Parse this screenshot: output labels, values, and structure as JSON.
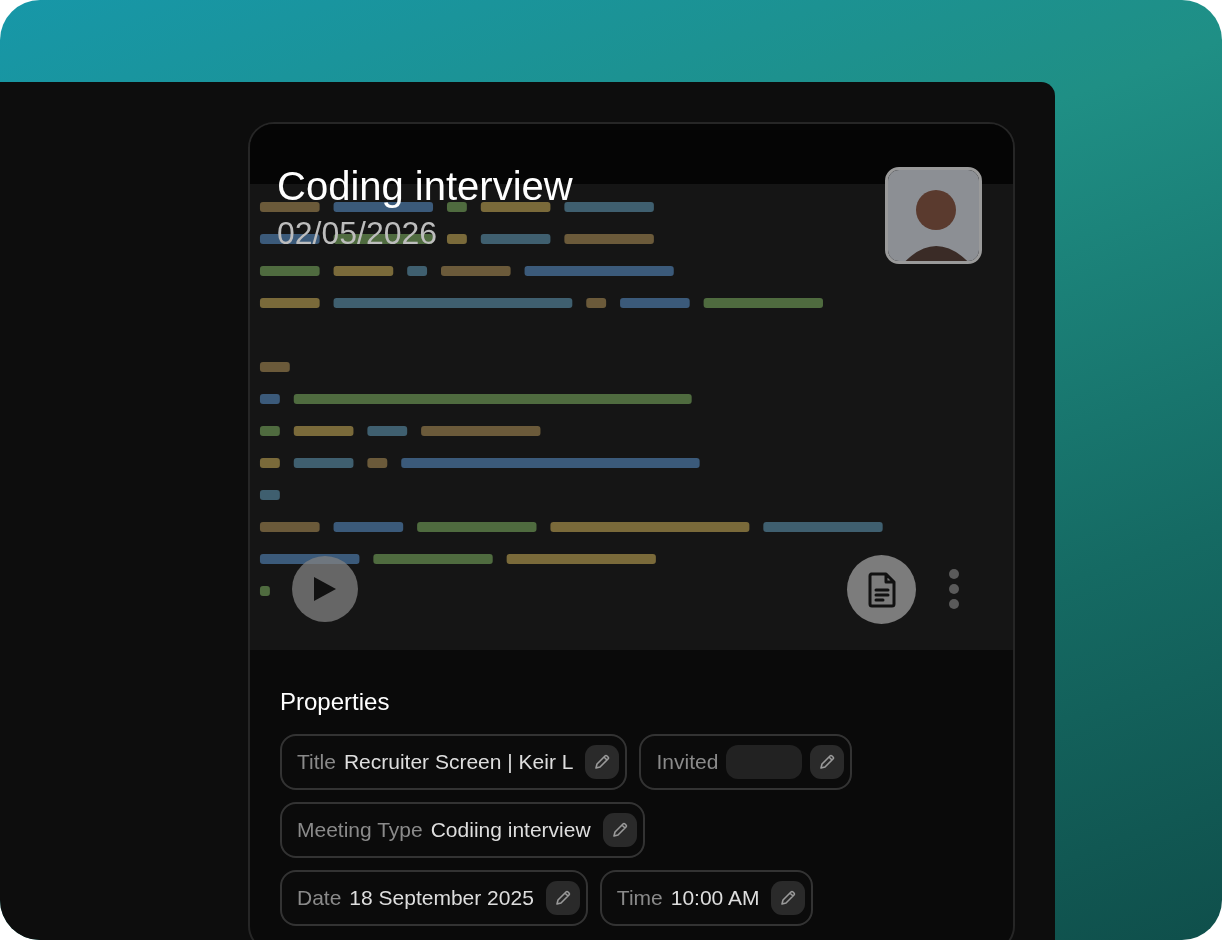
{
  "recording": {
    "title": "Coding interview",
    "date": "02/05/2026"
  },
  "properties": {
    "heading": "Properties",
    "rows": [
      [
        {
          "kind": "text",
          "label": "Title",
          "value": "Recruiter Screen | Keir L"
        },
        {
          "kind": "empty",
          "label": "Invited"
        }
      ],
      [
        {
          "kind": "text",
          "label": "Meeting Type",
          "value": "Codiing interview"
        }
      ],
      [
        {
          "kind": "text",
          "label": "Date",
          "value": "18 September 2025"
        },
        {
          "kind": "text",
          "label": "Time",
          "value": "10:00 AM"
        }
      ]
    ]
  }
}
